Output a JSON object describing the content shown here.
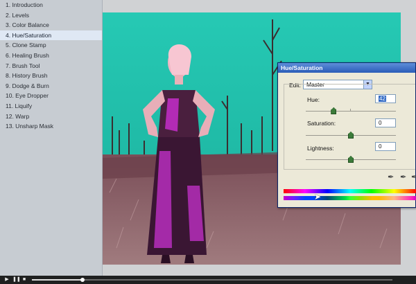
{
  "sidebar": {
    "lessons": [
      {
        "label": "1. Introduction"
      },
      {
        "label": "2. Levels"
      },
      {
        "label": "3. Color Balance"
      },
      {
        "label": "4. Hue/Saturation",
        "active": true
      },
      {
        "label": "5. Clone Stamp"
      },
      {
        "label": "6. Healing Brush"
      },
      {
        "label": "7. Brush Tool"
      },
      {
        "label": "8. History Brush"
      },
      {
        "label": "9. Dodge & Burn"
      },
      {
        "label": "10. Eye Dropper"
      },
      {
        "label": "11. Liquify"
      },
      {
        "label": "12. Warp"
      },
      {
        "label": "13. Unsharp Mask"
      }
    ]
  },
  "dialog": {
    "title": "Hue/Saturation",
    "edit_label": "Edit:",
    "edit_value": "Master",
    "hue": {
      "label": "Hue:",
      "value": "42",
      "slider_fraction": 0.31
    },
    "saturation": {
      "label": "Saturation:",
      "value": "0",
      "slider_fraction": 0.5
    },
    "lightness": {
      "label": "Lightness:",
      "value": "0",
      "slider_fraction": 0.5
    }
  },
  "player": {
    "play_icon": "play-icon",
    "pause_icon": "pause-icon",
    "stop_icon": "stop-icon",
    "progress_fraction": 0.14
  },
  "colors": {
    "sky": "#1ec0a8",
    "sidebar_bg": "#c7ccd2",
    "dialog_title": "#2b5cb8",
    "player_bg": "#1f2020"
  }
}
